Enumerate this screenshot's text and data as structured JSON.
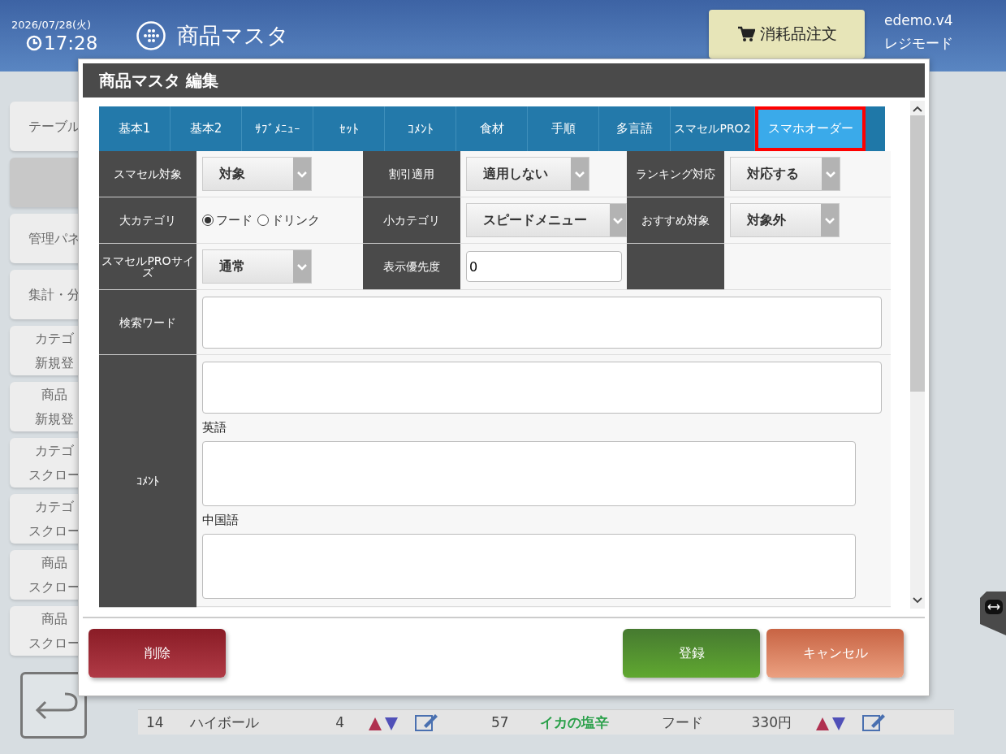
{
  "header": {
    "date": "2026/07/28(火)",
    "time": "17:28",
    "title": "商品マスタ",
    "order_button": "消耗品注文",
    "user": "edemo.v4",
    "mode": "レジモード"
  },
  "sidebar": [
    {
      "lines": [
        "テーブル"
      ],
      "selected": false
    },
    {
      "selected": true
    },
    {
      "lines": [
        "管理パネ"
      ],
      "selected": false
    },
    {
      "lines": [
        "集計・分"
      ],
      "selected": false
    },
    {
      "lines": [
        "カテゴ",
        "新規登"
      ],
      "selected": false
    },
    {
      "lines": [
        "商品",
        "新規登"
      ],
      "selected": false
    },
    {
      "lines": [
        "カテゴ",
        "スクロー"
      ],
      "selected": false
    },
    {
      "lines": [
        "カテゴ",
        "スクロー"
      ],
      "selected": false
    },
    {
      "lines": [
        "商品",
        "スクロー"
      ],
      "selected": false
    },
    {
      "lines": [
        "商品",
        "スクロー"
      ],
      "selected": false
    }
  ],
  "background_table": {
    "left_row": [
      "14",
      "ハイボール",
      "4"
    ],
    "right_row": [
      "57",
      "イカの塩辛",
      "フード",
      "330円"
    ]
  },
  "dialog": {
    "title": "商品マスタ 編集",
    "tabs": [
      {
        "label": "基本1",
        "selected": false
      },
      {
        "label": "基本2",
        "selected": false
      },
      {
        "label": "ｻﾌﾞﾒﾆｭｰ",
        "selected": false
      },
      {
        "label": "ｾｯﾄ",
        "selected": false
      },
      {
        "label": "ｺﾒﾝﾄ",
        "selected": false
      },
      {
        "label": "食材",
        "selected": false
      },
      {
        "label": "手順",
        "selected": false
      },
      {
        "label": "多言語",
        "selected": false
      },
      {
        "label": "スマセルPRO2",
        "selected": false
      },
      {
        "label": "スマホオーダー",
        "selected": true
      }
    ],
    "form_rows": [
      [
        {
          "label": "スマセル対象",
          "kind": "select",
          "value": "対象"
        },
        {
          "label": "割引適用",
          "kind": "select",
          "value": "適用しない"
        },
        {
          "label": "ランキング対応",
          "kind": "select",
          "value": "対応する"
        }
      ],
      [
        {
          "label": "大カテゴリ",
          "kind": "radio",
          "options": [
            {
              "label": "フード",
              "selected": true
            },
            {
              "label": "ドリンク",
              "selected": false
            }
          ]
        },
        {
          "label": "小カテゴリ",
          "kind": "select",
          "value": "スピードメニュー"
        },
        {
          "label": "おすすめ対象",
          "kind": "select",
          "value": "対象外"
        }
      ],
      [
        {
          "label": "スマセルPROサイズ",
          "kind": "select",
          "value": "通常"
        },
        {
          "label": "表示優先度",
          "kind": "text",
          "value": "0"
        },
        {
          "kind": "empty"
        }
      ]
    ],
    "search_word": {
      "label": "検索ワード"
    },
    "comment": {
      "label": "ｺﾒﾝﾄ",
      "fields": [
        {
          "kind": "textarea"
        },
        {
          "kind": "textarea",
          "label": "英語"
        },
        {
          "kind": "textarea",
          "label": "中国語"
        }
      ]
    },
    "buttons": [
      {
        "label": "削除",
        "kind": "delete"
      },
      {
        "label": "登録",
        "kind": "register"
      },
      {
        "label": "キャンセル",
        "kind": "cancel"
      }
    ]
  }
}
